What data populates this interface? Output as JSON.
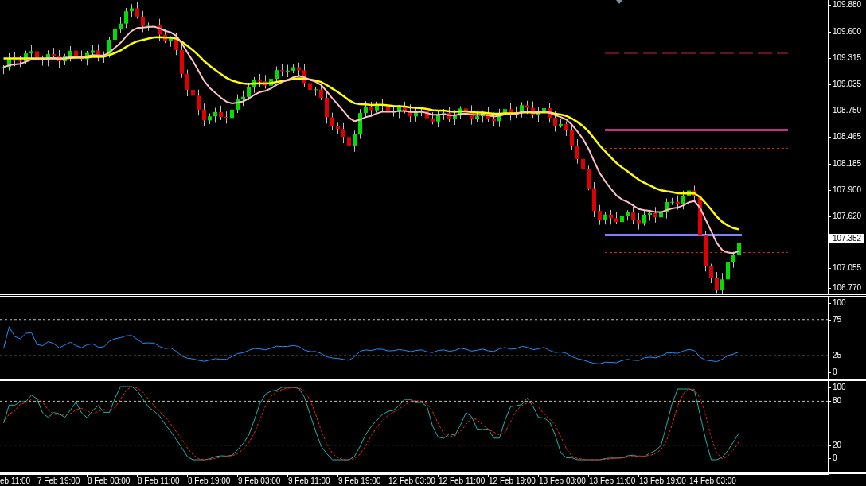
{
  "price_axis": {
    "labels": [
      "109.880",
      "109.600",
      "109.315",
      "109.035",
      "108.750",
      "108.465",
      "108.185",
      "107.900",
      "107.620",
      "107.055",
      "106.770"
    ],
    "current_price": "107.352"
  },
  "rsi_axis": {
    "labels": [
      "100",
      "75",
      "25",
      "0"
    ]
  },
  "stochastic_axis": {
    "labels": [
      "100",
      "80",
      "20",
      "0"
    ]
  },
  "time_axis": {
    "labels": [
      "eb 11:00",
      "7 Feb 19:00",
      "8 Feb 03:00",
      "8 Feb 11:00",
      "8 Feb 19:00",
      "9 Feb 03:00",
      "9 Feb 11:00",
      "9 Feb 19:00",
      "12 Feb 03:00",
      "12 Feb 11:00",
      "12 Feb 19:00",
      "13 Feb 03:00",
      "13 Feb 11:00",
      "13 Feb 19:00",
      "14 Feb 03:00"
    ]
  }
}
